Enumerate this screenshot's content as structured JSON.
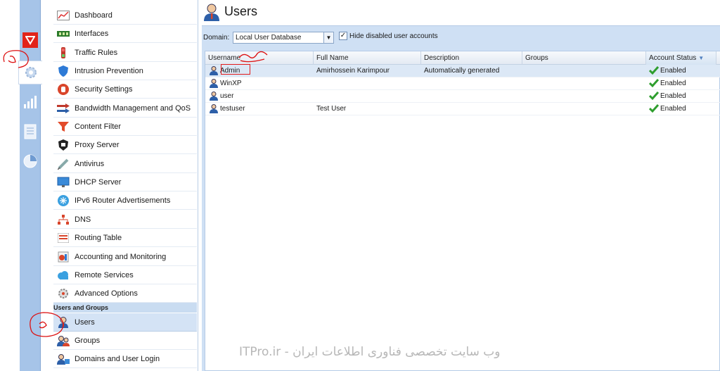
{
  "sidebar": {
    "items": [
      {
        "label": "Dashboard",
        "icon": "dashboard-icon"
      },
      {
        "label": "Interfaces",
        "icon": "interfaces-icon"
      },
      {
        "label": "Traffic Rules",
        "icon": "traffic-rules-icon"
      },
      {
        "label": "Intrusion Prevention",
        "icon": "shield-icon"
      },
      {
        "label": "Security Settings",
        "icon": "security-hand-icon"
      },
      {
        "label": "Bandwidth Management and QoS",
        "icon": "bandwidth-icon"
      },
      {
        "label": "Content Filter",
        "icon": "funnel-icon"
      },
      {
        "label": "Proxy Server",
        "icon": "proxy-icon"
      },
      {
        "label": "Antivirus",
        "icon": "syringe-icon"
      },
      {
        "label": "DHCP Server",
        "icon": "monitor-icon"
      },
      {
        "label": "IPv6 Router Advertisements",
        "icon": "ipv6-icon"
      },
      {
        "label": "DNS",
        "icon": "dns-tree-icon"
      },
      {
        "label": "Routing Table",
        "icon": "routing-icon"
      },
      {
        "label": "Accounting and Monitoring",
        "icon": "accounting-icon"
      },
      {
        "label": "Remote Services",
        "icon": "cloud-icon"
      },
      {
        "label": "Advanced Options",
        "icon": "gear-icon"
      }
    ],
    "section_title": "Users and Groups",
    "section_items": [
      {
        "label": "Users",
        "icon": "user-icon"
      },
      {
        "label": "Groups",
        "icon": "group-icon"
      },
      {
        "label": "Domains and User Login",
        "icon": "domain-icon"
      }
    ]
  },
  "page": {
    "title": "Users"
  },
  "toolbar": {
    "domain_label": "Domain:",
    "domain_value": "Local User Database",
    "hide_disabled_label": "Hide disabled user accounts",
    "hide_disabled_checked": true
  },
  "table": {
    "columns": [
      "Username",
      "Full Name",
      "Description",
      "Groups",
      "Account Status"
    ],
    "sorted_column": "Account Status",
    "rows": [
      {
        "username": "Admin",
        "full_name": "Amirhossein Karimpour",
        "description": "Automatically generated",
        "groups": "",
        "status": "Enabled"
      },
      {
        "username": "WinXP",
        "full_name": "",
        "description": "",
        "groups": "",
        "status": "Enabled"
      },
      {
        "username": "user",
        "full_name": "",
        "description": "",
        "groups": "",
        "status": "Enabled"
      },
      {
        "username": "testuser",
        "full_name": "Test User",
        "description": "",
        "groups": "",
        "status": "Enabled"
      }
    ]
  },
  "watermark": "ITPro.ir - وب سایت تخصصی فناوری اطلاعات ایران",
  "colors": {
    "rail": "#a6c4e8",
    "accent_red": "#e21b1b",
    "selected_row": "#dce8f6",
    "band": "#cfe0f4"
  }
}
